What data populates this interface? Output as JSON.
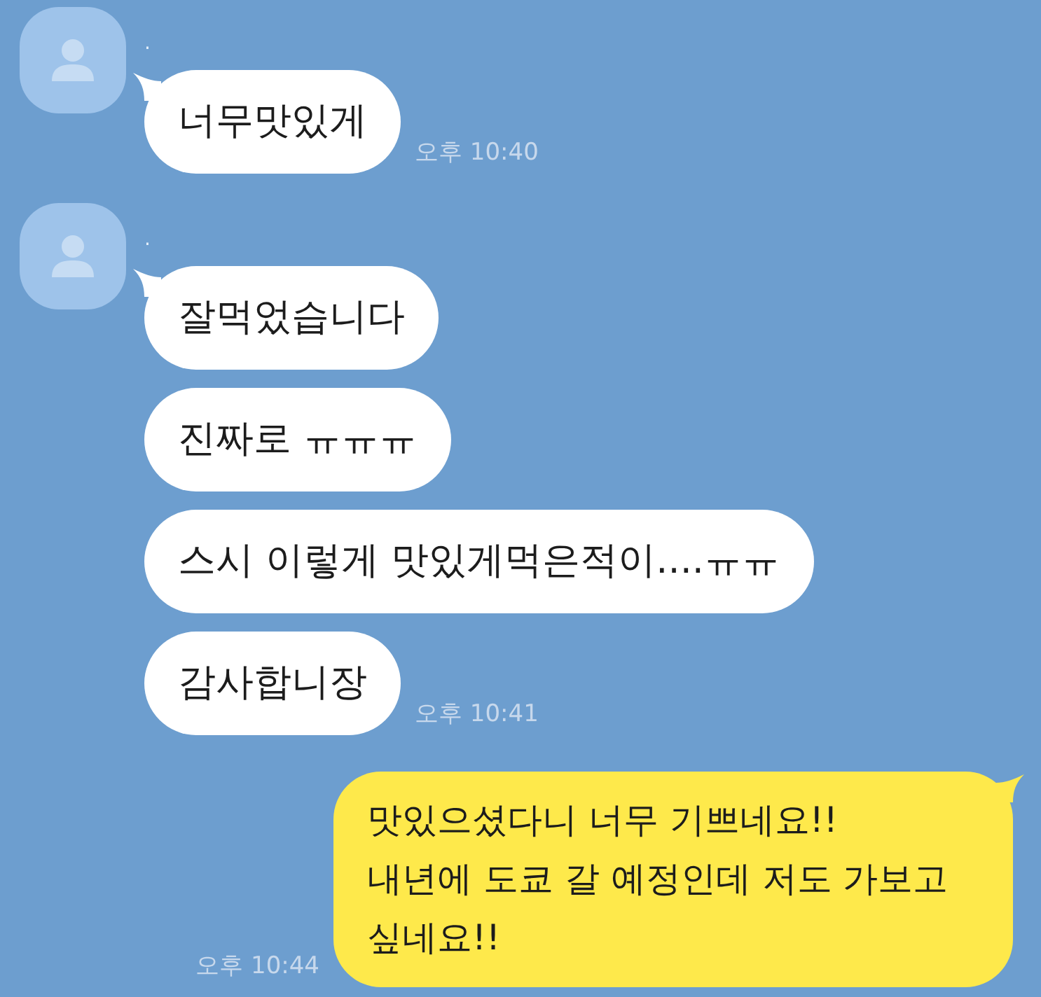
{
  "messages": [
    {
      "kind": "incoming",
      "sender": ".",
      "bubbles": [
        "너무맛있게"
      ],
      "time": "오후 10:40"
    },
    {
      "kind": "incoming",
      "sender": ".",
      "bubbles": [
        "잘먹었습니다",
        "진짜로 ㅠㅠㅠ",
        "스시 이렇게 맛있게먹은적이....ㅠㅠ",
        "감사합니장"
      ],
      "time": "오후 10:41"
    },
    {
      "kind": "outgoing",
      "lines": [
        "맛있으셨다니 너무 기쁘네요!!",
        "내년에 도쿄 갈 예정인데 저도 가보고",
        "싶네요!!"
      ],
      "time": "오후 10:44"
    }
  ]
}
